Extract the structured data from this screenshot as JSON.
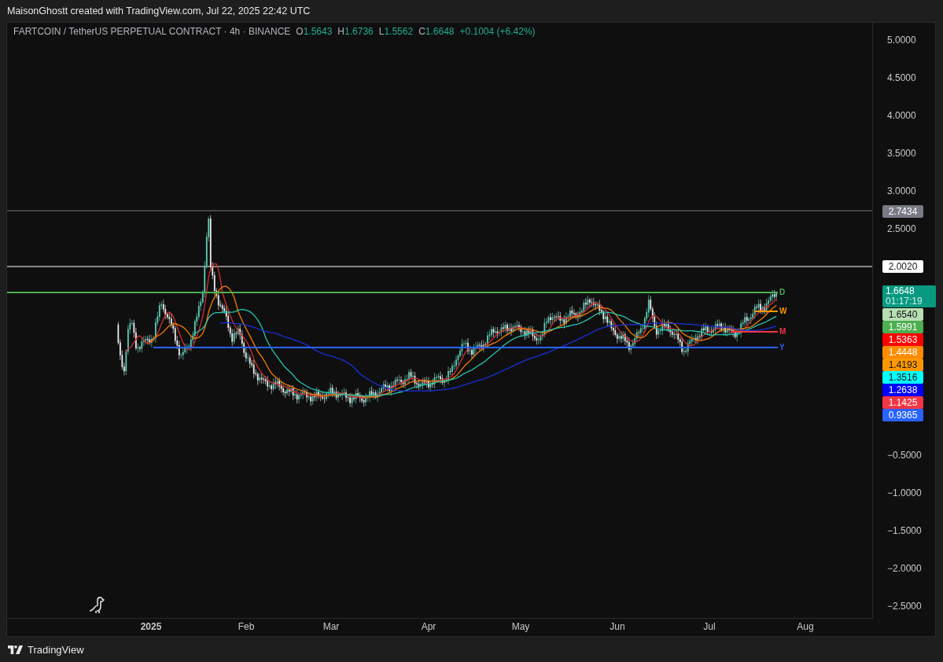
{
  "header": {
    "caption": "MaisonGhostt created with TradingView.com, Jul 22, 2025 22:42 UTC"
  },
  "legend": {
    "symbol": "FARTCOIN / TetherUS PERPETUAL CONTRACT · 4h · BINANCE",
    "ohlc": [
      {
        "label": "O",
        "value": "1.5643"
      },
      {
        "label": "H",
        "value": "1.6736"
      },
      {
        "label": "L",
        "value": "1.5562"
      },
      {
        "label": "C",
        "value": "1.6648"
      }
    ],
    "change": "+0.1004 (+6.42%)"
  },
  "chart_lines": [
    {
      "label": "D",
      "color": "#4caf50"
    },
    {
      "label": "W",
      "color": "#ff9800"
    },
    {
      "label": "M",
      "color": "#f23645"
    },
    {
      "label": "Y",
      "color": "#2962ff"
    }
  ],
  "price_axis": {
    "ticks_upper": [
      "5.0000",
      "4.5000",
      "4.0000",
      "3.5000",
      "3.0000",
      "2.5000"
    ],
    "ticks_lower": [
      "−0.5000",
      "−1.0000",
      "−1.5000",
      "−2.0000",
      "−2.5000"
    ],
    "level_tags": [
      {
        "value": "2.7434",
        "color": "#787b86",
        "dark_text": false
      },
      {
        "value": "2.0020",
        "color": "#ffffff",
        "dark_text": true
      }
    ],
    "last_price": {
      "value": "1.6648",
      "countdown": "01:17:19",
      "color": "#089981"
    },
    "indicator_tags": [
      {
        "value": "1.6540",
        "color": "#b7dfb4",
        "dark_text": true
      },
      {
        "value": "1.5991",
        "color": "#4caf50",
        "dark_text": false
      },
      {
        "value": "1.5363",
        "color": "#ff0000",
        "dark_text": false
      },
      {
        "value": "1.4448",
        "color": "#ff8c00",
        "dark_text": false
      },
      {
        "value": "1.4193",
        "color": "#ff9800",
        "dark_text": true
      },
      {
        "value": "1.3516",
        "color": "#00ffff",
        "dark_text": true
      },
      {
        "value": "1.2638",
        "color": "#0000ff",
        "dark_text": false
      },
      {
        "value": "1.1425",
        "color": "#f23645",
        "dark_text": false
      },
      {
        "value": "0.9365",
        "color": "#2962ff",
        "dark_text": false
      }
    ]
  },
  "time_axis": [
    {
      "label": "2025",
      "bold": true
    },
    {
      "label": "Feb",
      "bold": false
    },
    {
      "label": "Mar",
      "bold": false
    },
    {
      "label": "Apr",
      "bold": false
    },
    {
      "label": "May",
      "bold": false
    },
    {
      "label": "Jun",
      "bold": false
    },
    {
      "label": "Jul",
      "bold": false
    },
    {
      "label": "Aug",
      "bold": false
    }
  ],
  "footer": {
    "brand": "TradingView"
  }
}
